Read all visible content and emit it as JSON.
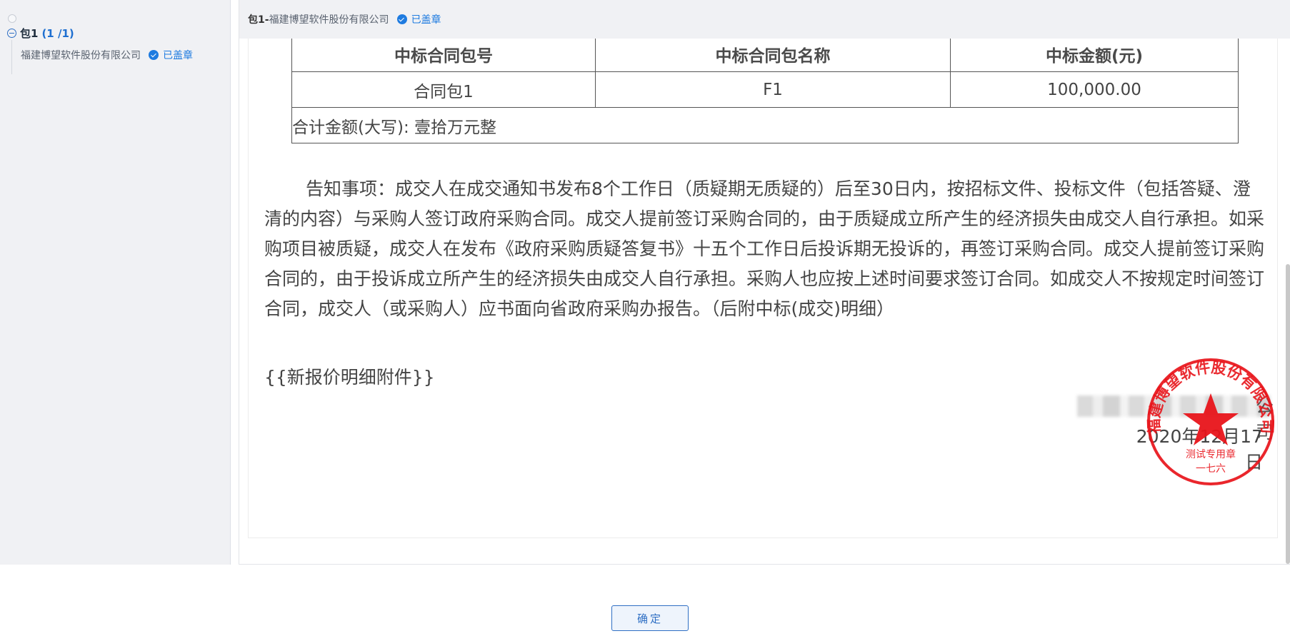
{
  "sidebar": {
    "root_label": "包1",
    "root_count_current": "1",
    "root_count_total": "/1",
    "child_company": "福建博望软件股份有限公司",
    "child_status": "已盖章"
  },
  "header": {
    "package": "包1-",
    "company": "福建博望软件股份有限公司",
    "status": "已盖章"
  },
  "table": {
    "headers": [
      "中标合同包号",
      "中标合同包名称",
      "中标金额(元)"
    ],
    "rows": [
      [
        "合同包1",
        "F1",
        "100,000.00"
      ]
    ],
    "total_label": "合计金额(大写): 壹拾万元整"
  },
  "notice": "告知事项：成交人在成交通知书发布8个工作日（质疑期无质疑的）后至30日内，按招标文件、投标文件（包括答疑、澄清的内容）与采购人签订政府采购合同。成交人提前签订采购合同的，由于质疑成立所产生的经济损失由成交人自行承担。如采购项目被质疑，成交人在发布《政府采购质疑答复书》十五个工作日后投诉期无投诉的，再签订采购合同。成交人提前签订采购合同的，由于投诉成立所产生的经济损失由成交人自行承担。采购人也应按上述时间要求签订合同。如成交人不按规定时间签订合同，成交人（或采购人）应书面向省政府采购办报告。（后附中标(成交)明细）",
  "attachment_placeholder": "{{新报价明细附件}}",
  "signature": {
    "company_tail": "公司",
    "date": "2020年12月17日"
  },
  "seal": {
    "ring_text": "福建博望软件股份有限公司",
    "line1": "测试专用章",
    "line2": "一七六",
    "color": "#e8141a"
  },
  "confirm_label": "确定"
}
